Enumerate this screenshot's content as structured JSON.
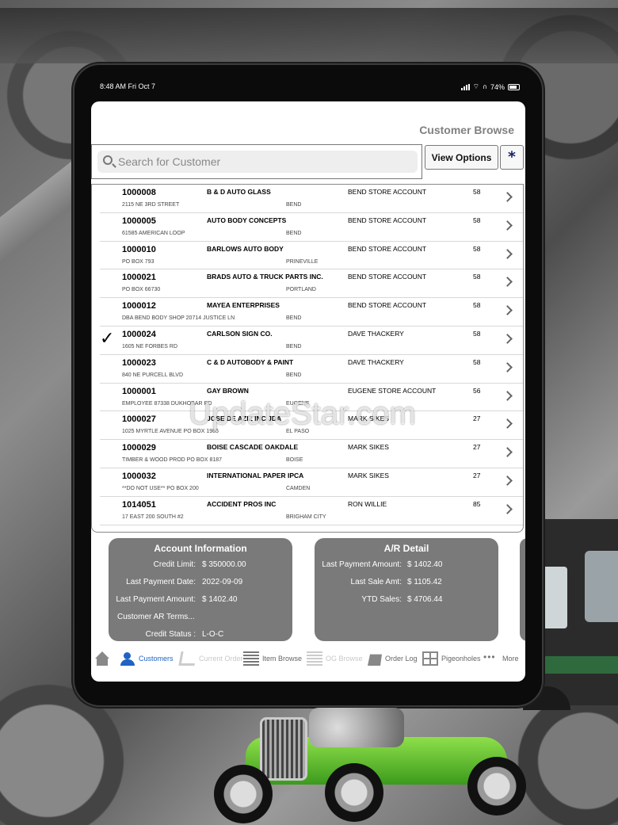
{
  "status_bar": {
    "time": "8:48 AM  Fri Oct 7",
    "battery": "74%"
  },
  "header": {
    "title": "Customer Browse"
  },
  "search": {
    "placeholder": "Search for Customer"
  },
  "toolbar": {
    "view_options_label": "View Options",
    "star_label": "*"
  },
  "customers": [
    {
      "id": "1000008",
      "name": "B & D AUTO GLASS",
      "address": "2115 NE 3RD STREET",
      "city": "BEND",
      "account": "BEND STORE ACCOUNT",
      "num": "58",
      "checked": false
    },
    {
      "id": "1000005",
      "name": "AUTO BODY CONCEPTS",
      "address": "61585 AMERICAN LOOP",
      "city": "BEND",
      "account": "BEND STORE ACCOUNT",
      "num": "58",
      "checked": false
    },
    {
      "id": "1000010",
      "name": "BARLOWS AUTO BODY",
      "address": "PO BOX 793",
      "city": "PRINEVILLE",
      "account": "BEND STORE ACCOUNT",
      "num": "58",
      "checked": false
    },
    {
      "id": "1000021",
      "name": "BRADS AUTO & TRUCK PARTS INC.",
      "address": "PO BOX 66730",
      "city": "PORTLAND",
      "account": "BEND STORE ACCOUNT",
      "num": "58",
      "checked": false
    },
    {
      "id": "1000012",
      "name": "MAYEA ENTERPRISES",
      "address": "DBA BEND BODY SHOP 20714 JUSTICE LN",
      "city": "BEND",
      "account": "BEND STORE ACCOUNT",
      "num": "58",
      "checked": false
    },
    {
      "id": "1000024",
      "name": "CARLSON SIGN CO.",
      "address": "1605 NE FORBES RD",
      "city": "BEND",
      "account": "DAVE THACKERY",
      "num": "58",
      "checked": true
    },
    {
      "id": "1000023",
      "name": "C & D AUTOBODY & PAINT",
      "address": "840 NE PURCELL BLVD",
      "city": "BEND",
      "account": "DAVE THACKERY",
      "num": "58",
      "checked": false
    },
    {
      "id": "1000001",
      "name": "GAY BROWN",
      "address": "EMPLOYEE 87338 DUKHOBAR RD",
      "city": "EUGENE",
      "account": "EUGENE STORE ACCOUNT",
      "num": "56",
      "checked": false
    },
    {
      "id": "1000027",
      "name": "JOSE DE AZIZ INC JDA",
      "address": "1025 MYRTLE AVENUE PO BOX 1985",
      "city": "EL PASO",
      "account": "MARK SIKES",
      "num": "27",
      "checked": false
    },
    {
      "id": "1000029",
      "name": "BOISE CASCADE OAKDALE",
      "address": "TIMBER & WOOD PROD PO BOX 8187",
      "city": "BOISE",
      "account": "MARK SIKES",
      "num": "27",
      "checked": false
    },
    {
      "id": "1000032",
      "name": "INTERNATIONAL PAPER IPCA",
      "address": "**DO NOT USE** PO BOX 200",
      "city": "CAMDEN",
      "account": "MARK SIKES",
      "num": "27",
      "checked": false
    },
    {
      "id": "1014051",
      "name": "ACCIDENT PROS INC",
      "address": "17 EAST 200 SOUTH #2",
      "city": "BRIGHAM CITY",
      "account": "RON WILLIE",
      "num": "85",
      "checked": false
    }
  ],
  "account_info": {
    "title": "Account Information",
    "rows": [
      {
        "label": "Credit Limit:",
        "value": "$ 350000.00"
      },
      {
        "label": "Last Payment Date:",
        "value": "2022-09-09"
      },
      {
        "label": "Last Payment Amount:",
        "value": "$ 1402.40"
      },
      {
        "label": "Customer AR Terms...",
        "value": ""
      },
      {
        "label": "Credit Status :",
        "value": "L-O-C"
      }
    ]
  },
  "ar_detail": {
    "title": "A/R Detail",
    "rows": [
      {
        "label": "Last Payment Amount:",
        "value": "$ 1402.40"
      },
      {
        "label": "Last Sale Amt:",
        "value": "$ 1105.42"
      },
      {
        "label": "YTD Sales:",
        "value": "$ 4706.44"
      }
    ]
  },
  "tabs": [
    {
      "label": "",
      "icon": "home-icon"
    },
    {
      "label": "Customers",
      "icon": "users-icon",
      "active": true
    },
    {
      "label": "Current Order",
      "icon": "cart-icon",
      "disabled": true
    },
    {
      "label": "Item Browse",
      "icon": "list-icon"
    },
    {
      "label": "OG Browse",
      "icon": "list-icon",
      "disabled": true
    },
    {
      "label": "Order Log",
      "icon": "book-icon"
    },
    {
      "label": "Pigeonholes",
      "icon": "grid-icon"
    },
    {
      "label": "More",
      "icon": "dots-icon"
    }
  ],
  "colors": {
    "accent": "#1f63c4",
    "panel": "#7a7a7a",
    "title": "#808080",
    "star": "#17226a"
  },
  "watermark": "UpdateStar.com"
}
